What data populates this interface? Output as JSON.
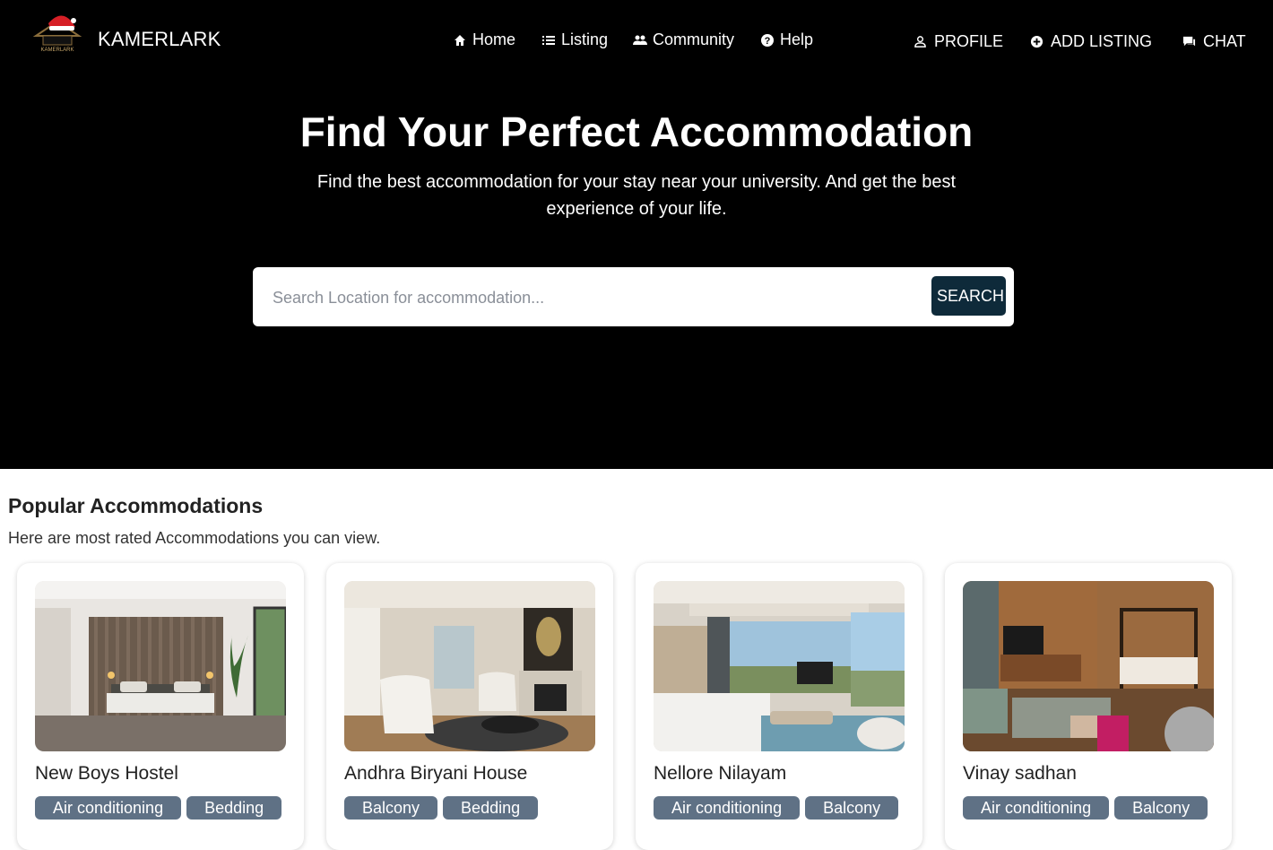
{
  "header": {
    "brand": "KAMERLARK",
    "logo_text": "KAMERLARK",
    "nav": [
      {
        "label": "Home",
        "icon": "home-icon"
      },
      {
        "label": "Listing",
        "icon": "list-icon"
      },
      {
        "label": "Community",
        "icon": "people-icon"
      },
      {
        "label": "Help",
        "icon": "help-icon"
      }
    ],
    "actions": [
      {
        "label": "PROFILE",
        "icon": "person-icon"
      },
      {
        "label": "ADD LISTING",
        "icon": "add-circle-icon"
      },
      {
        "label": "CHAT",
        "icon": "chat-icon"
      }
    ]
  },
  "hero": {
    "title": "Find Your Perfect Accommodation",
    "subtitle": "Find the best accommodation for your stay near your university. And get the best experience of your life."
  },
  "search": {
    "placeholder": "Search Location for accommodation...",
    "value": "",
    "button_label": "SEARCH"
  },
  "popular": {
    "title": "Popular Accommodations",
    "subtitle": "Here are most rated Accommodations you can view.",
    "cards": [
      {
        "name": "New Boys Hostel",
        "tags": [
          "Air conditioning",
          "Bedding"
        ]
      },
      {
        "name": "Andhra Biryani House",
        "tags": [
          "Balcony",
          "Bedding"
        ]
      },
      {
        "name": "Nellore Nilayam",
        "tags": [
          "Air conditioning",
          "Balcony"
        ]
      },
      {
        "name": "Vinay sadhan",
        "tags": [
          "Air conditioning",
          "Balcony"
        ]
      }
    ]
  },
  "colors": {
    "hero_bg": "#000000",
    "search_button": "#0e2a3a",
    "tag_bg": "#5f7185",
    "logo_hat": "#d61f26"
  }
}
